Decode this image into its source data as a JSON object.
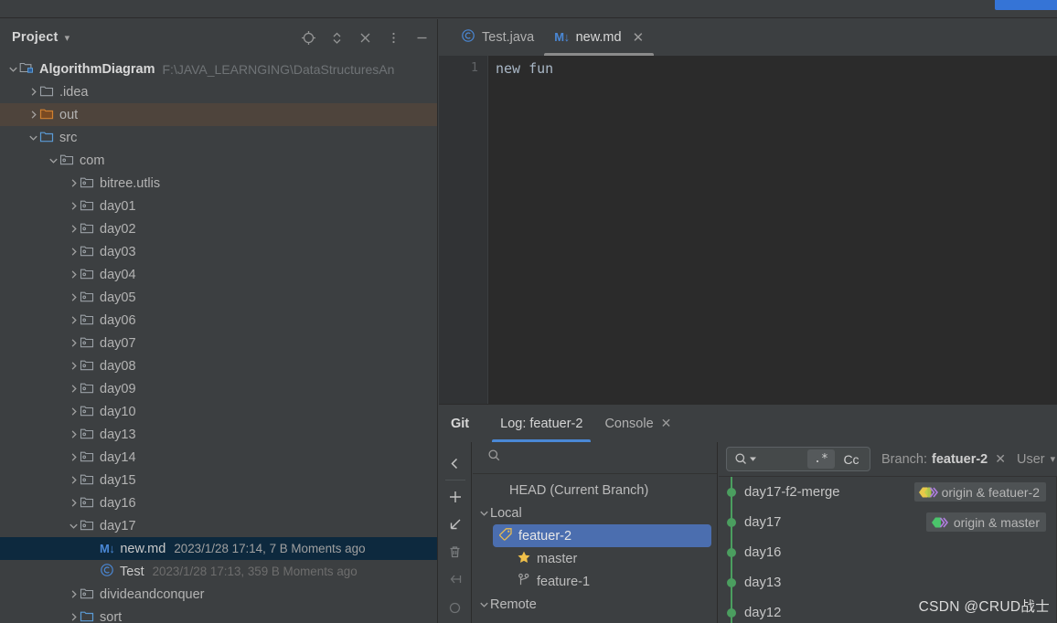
{
  "window": {
    "progress_color": "#3574d6"
  },
  "project_panel": {
    "title": "Project",
    "dropdown_icon": "chevron-down-icon",
    "actions": [
      {
        "name": "locate-icon",
        "tooltip": "Select Opened File"
      },
      {
        "name": "expand-collapse-icon",
        "tooltip": "Expand All"
      },
      {
        "name": "collapse-all-icon",
        "tooltip": "Collapse All"
      },
      {
        "name": "more-options-icon",
        "tooltip": "Options"
      },
      {
        "name": "minimize-icon",
        "tooltip": "Hide"
      }
    ],
    "tree": [
      {
        "label": "AlgorithmDiagram",
        "meta": "F:\\JAVA_LEARNGING\\DataStructuresAn",
        "icon": "module-icon",
        "twisty": "down",
        "depth": 0,
        "kind": "root"
      },
      {
        "label": ".idea",
        "icon": "folder-plain-icon",
        "twisty": "right",
        "depth": 1,
        "kind": "folder"
      },
      {
        "label": "out",
        "icon": "folder-orange-icon",
        "twisty": "right",
        "depth": 1,
        "kind": "folder",
        "highlight": "out"
      },
      {
        "label": "src",
        "icon": "folder-blue-icon",
        "twisty": "down",
        "depth": 1,
        "kind": "folder"
      },
      {
        "label": "com",
        "icon": "package-icon",
        "twisty": "down",
        "depth": 2,
        "kind": "package"
      },
      {
        "label": "bitree.utlis",
        "icon": "package-icon",
        "twisty": "right",
        "depth": 3,
        "kind": "package"
      },
      {
        "label": "day01",
        "icon": "package-icon",
        "twisty": "right",
        "depth": 3,
        "kind": "package"
      },
      {
        "label": "day02",
        "icon": "package-icon",
        "twisty": "right",
        "depth": 3,
        "kind": "package"
      },
      {
        "label": "day03",
        "icon": "package-icon",
        "twisty": "right",
        "depth": 3,
        "kind": "package"
      },
      {
        "label": "day04",
        "icon": "package-icon",
        "twisty": "right",
        "depth": 3,
        "kind": "package"
      },
      {
        "label": "day05",
        "icon": "package-icon",
        "twisty": "right",
        "depth": 3,
        "kind": "package"
      },
      {
        "label": "day06",
        "icon": "package-icon",
        "twisty": "right",
        "depth": 3,
        "kind": "package"
      },
      {
        "label": "day07",
        "icon": "package-icon",
        "twisty": "right",
        "depth": 3,
        "kind": "package"
      },
      {
        "label": "day08",
        "icon": "package-icon",
        "twisty": "right",
        "depth": 3,
        "kind": "package"
      },
      {
        "label": "day09",
        "icon": "package-icon",
        "twisty": "right",
        "depth": 3,
        "kind": "package"
      },
      {
        "label": "day10",
        "icon": "package-icon",
        "twisty": "right",
        "depth": 3,
        "kind": "package"
      },
      {
        "label": "day13",
        "icon": "package-icon",
        "twisty": "right",
        "depth": 3,
        "kind": "package"
      },
      {
        "label": "day14",
        "icon": "package-icon",
        "twisty": "right",
        "depth": 3,
        "kind": "package"
      },
      {
        "label": "day15",
        "icon": "package-icon",
        "twisty": "right",
        "depth": 3,
        "kind": "package"
      },
      {
        "label": "day16",
        "icon": "package-icon",
        "twisty": "right",
        "depth": 3,
        "kind": "package"
      },
      {
        "label": "day17",
        "icon": "package-icon",
        "twisty": "down",
        "depth": 3,
        "kind": "package"
      },
      {
        "label": "new.md",
        "meta": "2023/1/28 17:14, 7 B Moments ago",
        "icon": "markdown-icon",
        "twisty": "none",
        "depth": 4,
        "kind": "file",
        "selected": true
      },
      {
        "label": "Test",
        "meta": "2023/1/28 17:13, 359 B Moments ago",
        "icon": "java-class-icon",
        "twisty": "none",
        "depth": 4,
        "kind": "file"
      },
      {
        "label": "divideandconquer",
        "icon": "package-icon",
        "twisty": "right",
        "depth": 3,
        "kind": "package"
      },
      {
        "label": "sort",
        "icon": "folder-blue-icon",
        "twisty": "right",
        "depth": 3,
        "kind": "folder",
        "clipped": true
      }
    ]
  },
  "editor": {
    "tabs": [
      {
        "label": "Test.java",
        "icon": "java-class-icon",
        "active": false,
        "closable": false
      },
      {
        "label": "new.md",
        "icon": "markdown-icon",
        "active": true,
        "closable": true,
        "close_icon": "close-icon"
      }
    ],
    "line_number": "1",
    "content": "new fun"
  },
  "git_window": {
    "title": "Git",
    "tabs": [
      {
        "label": "Log: featuer-2",
        "active": true,
        "closable": false
      },
      {
        "label": "Console",
        "active": false,
        "closable": true,
        "close_icon": "close-icon"
      }
    ],
    "toolbar": [
      {
        "name": "collapse-left-icon"
      },
      {
        "name": "plus-icon"
      },
      {
        "name": "checkout-arrow-icon"
      },
      {
        "name": "trash-icon"
      },
      {
        "name": "merge-arrow-icon"
      },
      {
        "name": "refresh-icon"
      }
    ],
    "branch_pane": {
      "search_icon": "search-icon",
      "search_placeholder": "",
      "items": [
        {
          "label": "HEAD (Current Branch)",
          "kind": "head",
          "depth": 1,
          "twisty": "none",
          "icon": null
        },
        {
          "label": "Local",
          "kind": "group",
          "depth": 0,
          "twisty": "down",
          "icon": null
        },
        {
          "label": "featuer-2",
          "kind": "branch",
          "depth": 2,
          "twisty": "none",
          "icon": "tag-icon",
          "selected": true
        },
        {
          "label": "master",
          "kind": "branch",
          "depth": 2,
          "twisty": "none",
          "icon": "star-icon"
        },
        {
          "label": "feature-1",
          "kind": "branch",
          "depth": 2,
          "twisty": "none",
          "icon": "branch-icon"
        },
        {
          "label": "Remote",
          "kind": "group",
          "depth": 0,
          "twisty": "down",
          "icon": null
        }
      ]
    },
    "filter_bar": {
      "search_icon": "search-dropdown-icon",
      "regex_label": ".*",
      "case_label": "Cc",
      "filters": [
        {
          "name": "branch-filter",
          "label": "Branch:",
          "value": "featuer-2",
          "clear_icon": "close-icon"
        },
        {
          "name": "user-filter",
          "label": "User",
          "value": "",
          "caret_icon": "chevron-down-icon"
        }
      ]
    },
    "commits": [
      {
        "subject": "day17-f2-merge",
        "refs": [
          {
            "label": "origin & featuer-2",
            "icon": "labels-yellow-icon"
          }
        ]
      },
      {
        "subject": "day17",
        "refs": [
          {
            "label": "origin & master",
            "icon": "labels-green-icon"
          }
        ]
      },
      {
        "subject": "day16",
        "refs": []
      },
      {
        "subject": "day13",
        "refs": []
      },
      {
        "subject": "day12",
        "refs": [],
        "clipped": true
      }
    ],
    "graph_color": "#4b9e5f"
  },
  "watermark": "CSDN @CRUD战士"
}
